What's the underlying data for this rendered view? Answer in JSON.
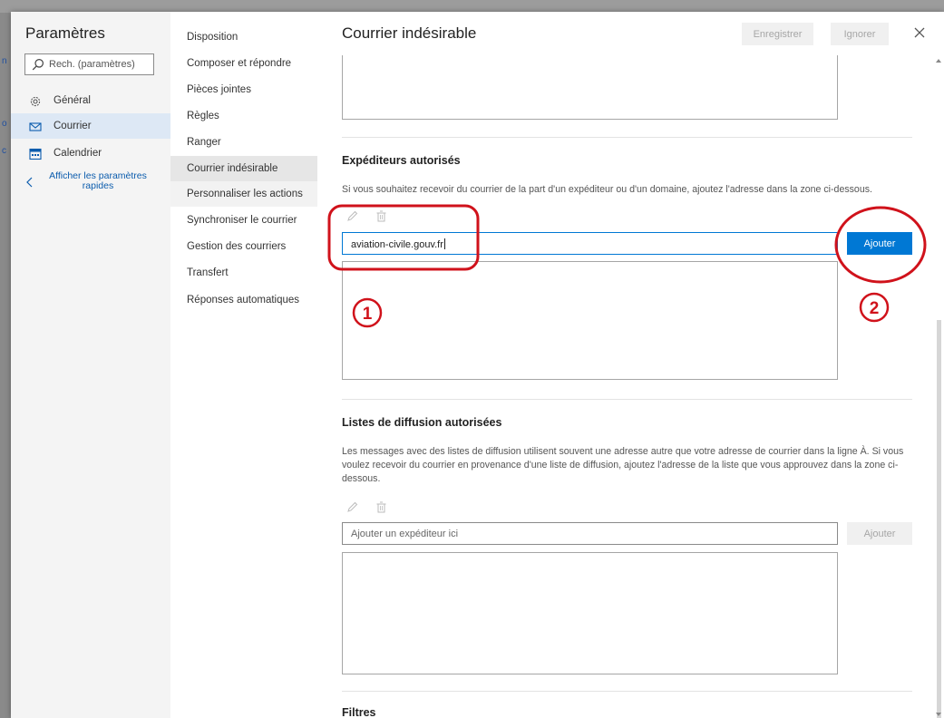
{
  "backdrop": {
    "edge_letters": [
      "n",
      "o",
      "c"
    ]
  },
  "sidebar": {
    "title": "Paramètres",
    "search_placeholder": "Rech. (paramètres)",
    "items": [
      {
        "label": "Général",
        "icon": "gear-icon"
      },
      {
        "label": "Courrier",
        "icon": "mail-icon",
        "selected": true
      },
      {
        "label": "Calendrier",
        "icon": "calendar-icon"
      }
    ],
    "back_link": {
      "line1": "Afficher les paramètres",
      "line2": "rapides"
    }
  },
  "subnav": {
    "items": [
      "Disposition",
      "Composer et répondre",
      "Pièces jointes",
      "Règles",
      "Ranger",
      "Courrier indésirable",
      "Personnaliser les actions",
      "Synchroniser le courrier",
      "Gestion des courriers",
      "Transfert",
      "Réponses automatiques"
    ],
    "selected_index": 5,
    "hover_index": 6
  },
  "main": {
    "title": "Courrier indésirable",
    "save_label": "Enregistrer",
    "ignore_label": "Ignorer",
    "safe_senders": {
      "title": "Expéditeurs autorisés",
      "description": "Si vous souhaitez recevoir du courrier de la part d'un expéditeur ou d'un domaine, ajoutez l'adresse dans la zone ci-dessous.",
      "input_value": "aviation-civile.gouv.fr",
      "add_label": "Ajouter"
    },
    "safe_lists": {
      "title": "Listes de diffusion autorisées",
      "description": "Les messages avec des listes de diffusion utilisent souvent une adresse autre que votre adresse de courrier dans la ligne À. Si vous voulez recevoir du courrier en provenance d'une liste de diffusion, ajoutez l'adresse de la liste que vous approuvez dans la zone ci-dessous.",
      "input_placeholder": "Ajouter un expéditeur ici",
      "add_label": "Ajouter"
    },
    "filters_title": "Filtres"
  },
  "annotations": {
    "step1": "1",
    "step2": "2",
    "color": "#d0121b"
  },
  "colors": {
    "accent": "#0078d4",
    "selected_nav": "#dde8f5",
    "link": "#0b5cad"
  }
}
